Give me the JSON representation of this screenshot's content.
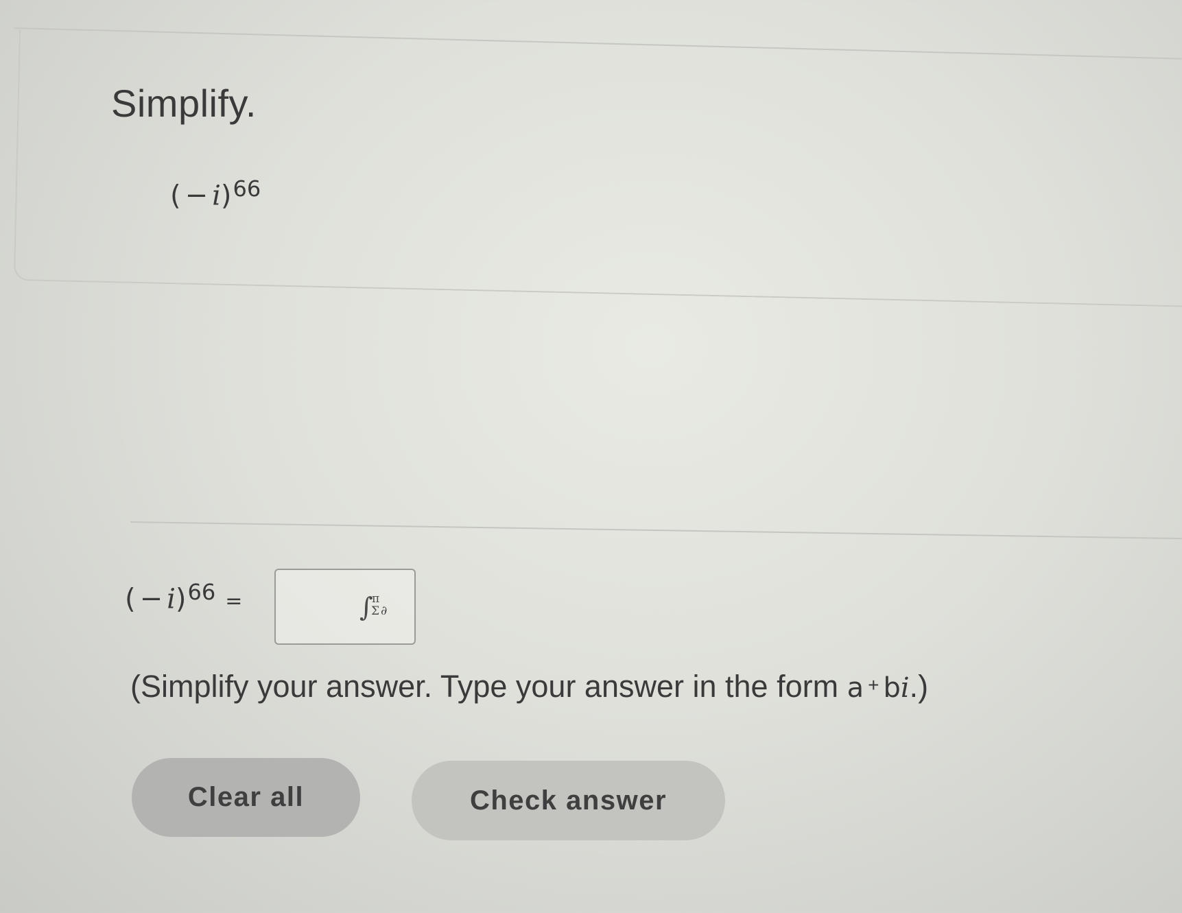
{
  "question": {
    "instruction": "Simplify.",
    "expression": {
      "open_paren": "(",
      "sign": "−",
      "variable": "i",
      "close_paren": ")",
      "exponent": "66"
    }
  },
  "answer_row": {
    "expression": {
      "open_paren": "(",
      "sign": "−",
      "variable": "i",
      "close_paren": ")",
      "exponent": "66"
    },
    "equals": "=",
    "input_value": "",
    "math_palette_icon": {
      "icon": "math-palette-icon",
      "integral": "∫",
      "pi": "π",
      "sigma": "Σ",
      "partial": "∂"
    }
  },
  "hint": {
    "prefix": "(Simplify your answer. Type your answer in the form ",
    "form_a": "a",
    "form_plus": "+",
    "form_b": "b",
    "form_i": "i",
    "suffix": ".)"
  },
  "buttons": {
    "clear_all": "Clear all",
    "check_answer": "Check answer"
  }
}
